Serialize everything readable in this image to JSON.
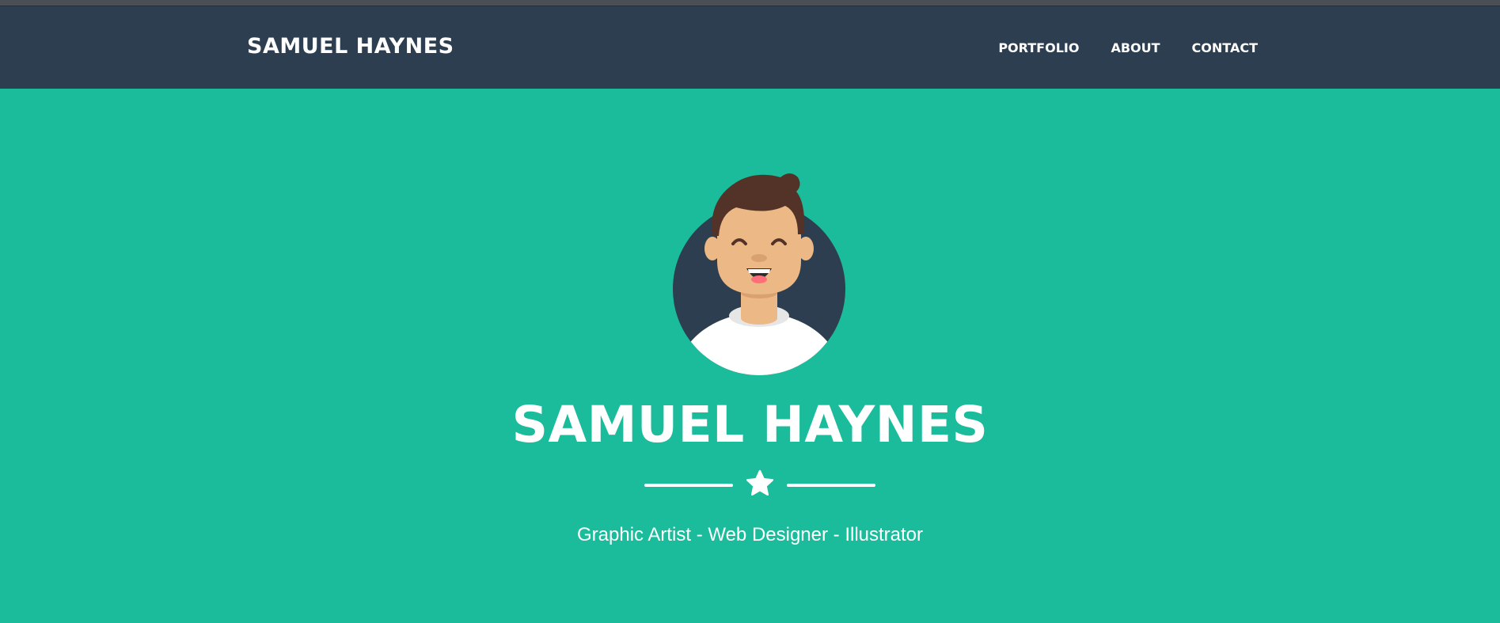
{
  "navbar": {
    "brand": "SAMUEL HAYNES",
    "links": [
      {
        "label": "PORTFOLIO"
      },
      {
        "label": "ABOUT"
      },
      {
        "label": "CONTACT"
      }
    ]
  },
  "hero": {
    "title": "SAMUEL HAYNES",
    "subtitle": "Graphic Artist - Web Designer - Illustrator",
    "avatar_icon": "avatar-illustration",
    "divider_icon": "star-icon"
  },
  "colors": {
    "navbar_bg": "#2c3e50",
    "hero_bg": "#1abc9c",
    "text": "#ffffff"
  }
}
